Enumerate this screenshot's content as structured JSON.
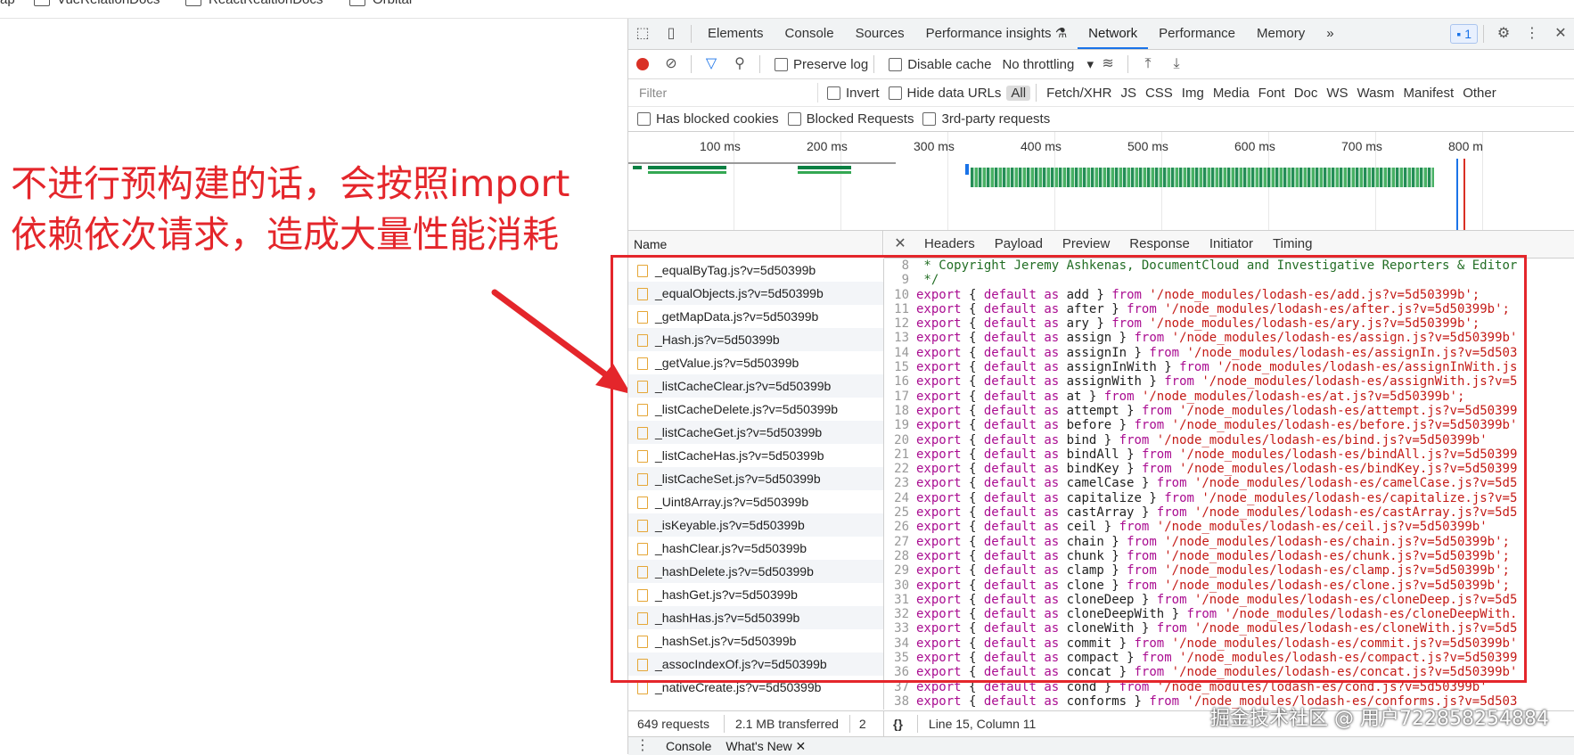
{
  "bookmarks": [
    "ap",
    "VueRelationDocs",
    "ReactRealtionDocs",
    "Orbital"
  ],
  "annotation": {
    "line1": "不进行预构建的话，会按照import",
    "line2": "依赖依次请求，造成大量性能消耗"
  },
  "devtools": {
    "tabs": [
      "Elements",
      "Console",
      "Sources",
      "Performance insights",
      "Network",
      "Performance",
      "Memory"
    ],
    "active_tab": "Network",
    "more_tabs": "»",
    "issues_badge": "1",
    "toolbar": {
      "preserve_log": "Preserve log",
      "disable_cache": "Disable cache",
      "throttling": "No throttling"
    },
    "filter": {
      "placeholder": "Filter",
      "invert": "Invert",
      "hide_data_urls": "Hide data URLs",
      "types": [
        "All",
        "Fetch/XHR",
        "JS",
        "CSS",
        "Img",
        "Media",
        "Font",
        "Doc",
        "WS",
        "Wasm",
        "Manifest",
        "Other"
      ],
      "active_type": "All",
      "has_blocked_cookies": "Has blocked cookies",
      "blocked_requests": "Blocked Requests",
      "third_party": "3rd-party requests"
    },
    "timeline": {
      "ticks": [
        "100 ms",
        "200 ms",
        "300 ms",
        "400 ms",
        "500 ms",
        "600 ms",
        "700 ms",
        "800 m"
      ]
    },
    "request_list": {
      "header": "Name",
      "items": [
        "_equalByTag.js?v=5d50399b",
        "_equalObjects.js?v=5d50399b",
        "_getMapData.js?v=5d50399b",
        "_Hash.js?v=5d50399b",
        "_getValue.js?v=5d50399b",
        "_listCacheClear.js?v=5d50399b",
        "_listCacheDelete.js?v=5d50399b",
        "_listCacheGet.js?v=5d50399b",
        "_listCacheHas.js?v=5d50399b",
        "_listCacheSet.js?v=5d50399b",
        "_Uint8Array.js?v=5d50399b",
        "_isKeyable.js?v=5d50399b",
        "_hashClear.js?v=5d50399b",
        "_hashDelete.js?v=5d50399b",
        "_hashGet.js?v=5d50399b",
        "_hashHas.js?v=5d50399b",
        "_hashSet.js?v=5d50399b",
        "_assocIndexOf.js?v=5d50399b",
        "_nativeCreate.js?v=5d50399b"
      ]
    },
    "detail_tabs": [
      "Headers",
      "Payload",
      "Preview",
      "Response",
      "Initiator",
      "Timing"
    ],
    "detail_active": "Preview",
    "preview": {
      "comment_lines": [
        {
          "n": "8",
          "t": " * Copyright Jeremy Ashkenas, DocumentCloud and Investigative Reporters & Editor"
        },
        {
          "n": "9",
          "t": " */"
        }
      ],
      "export_lines": [
        {
          "n": "10",
          "name": "add",
          "path": "'/node_modules/lodash-es/add.js?v=5d50399b';"
        },
        {
          "n": "11",
          "name": "after",
          "path": "'/node_modules/lodash-es/after.js?v=5d50399b';"
        },
        {
          "n": "12",
          "name": "ary",
          "path": "'/node_modules/lodash-es/ary.js?v=5d50399b';"
        },
        {
          "n": "13",
          "name": "assign",
          "path": "'/node_modules/lodash-es/assign.js?v=5d50399b'"
        },
        {
          "n": "14",
          "name": "assignIn",
          "path": "'/node_modules/lodash-es/assignIn.js?v=5d503"
        },
        {
          "n": "15",
          "name": "assignInWith",
          "path": "'/node_modules/lodash-es/assignInWith.js"
        },
        {
          "n": "16",
          "name": "assignWith",
          "path": "'/node_modules/lodash-es/assignWith.js?v=5"
        },
        {
          "n": "17",
          "name": "at",
          "path": "'/node_modules/lodash-es/at.js?v=5d50399b';"
        },
        {
          "n": "18",
          "name": "attempt",
          "path": "'/node_modules/lodash-es/attempt.js?v=5d50399"
        },
        {
          "n": "19",
          "name": "before",
          "path": "'/node_modules/lodash-es/before.js?v=5d50399b'"
        },
        {
          "n": "20",
          "name": "bind",
          "path": "'/node_modules/lodash-es/bind.js?v=5d50399b'"
        },
        {
          "n": "21",
          "name": "bindAll",
          "path": "'/node_modules/lodash-es/bindAll.js?v=5d50399"
        },
        {
          "n": "22",
          "name": "bindKey",
          "path": "'/node_modules/lodash-es/bindKey.js?v=5d50399"
        },
        {
          "n": "23",
          "name": "camelCase",
          "path": "'/node_modules/lodash-es/camelCase.js?v=5d5"
        },
        {
          "n": "24",
          "name": "capitalize",
          "path": "'/node_modules/lodash-es/capitalize.js?v=5"
        },
        {
          "n": "25",
          "name": "castArray",
          "path": "'/node_modules/lodash-es/castArray.js?v=5d5"
        },
        {
          "n": "26",
          "name": "ceil",
          "path": "'/node_modules/lodash-es/ceil.js?v=5d50399b'"
        },
        {
          "n": "27",
          "name": "chain",
          "path": "'/node_modules/lodash-es/chain.js?v=5d50399b';"
        },
        {
          "n": "28",
          "name": "chunk",
          "path": "'/node_modules/lodash-es/chunk.js?v=5d50399b';"
        },
        {
          "n": "29",
          "name": "clamp",
          "path": "'/node_modules/lodash-es/clamp.js?v=5d50399b';"
        },
        {
          "n": "30",
          "name": "clone",
          "path": "'/node_modules/lodash-es/clone.js?v=5d50399b';"
        },
        {
          "n": "31",
          "name": "cloneDeep",
          "path": "'/node_modules/lodash-es/cloneDeep.js?v=5d5"
        },
        {
          "n": "32",
          "name": "cloneDeepWith",
          "path": "'/node_modules/lodash-es/cloneDeepWith."
        },
        {
          "n": "33",
          "name": "cloneWith",
          "path": "'/node_modules/lodash-es/cloneWith.js?v=5d5"
        },
        {
          "n": "34",
          "name": "commit",
          "path": "'/node_modules/lodash-es/commit.js?v=5d50399b'"
        },
        {
          "n": "35",
          "name": "compact",
          "path": "'/node_modules/lodash-es/compact.js?v=5d50399"
        },
        {
          "n": "36",
          "name": "concat",
          "path": "'/node_modules/lodash-es/concat.js?v=5d50399b'"
        },
        {
          "n": "37",
          "name": "cond",
          "path": "'/node_modules/lodash-es/cond.js?v=5d50399b'"
        },
        {
          "n": "38",
          "name": "conforms",
          "path": "'/node_modules/lodash-es/conforms.js?v=5d503"
        }
      ]
    },
    "status": {
      "requests": "649 requests",
      "transferred": "2.1 MB transferred",
      "more": "2",
      "braces": "{}",
      "cursor": "Line 15, Column 11"
    },
    "drawer": {
      "console": "Console",
      "whats_new": "What's New"
    }
  },
  "watermark": "掘金技术社区 @ 用户722858254884"
}
